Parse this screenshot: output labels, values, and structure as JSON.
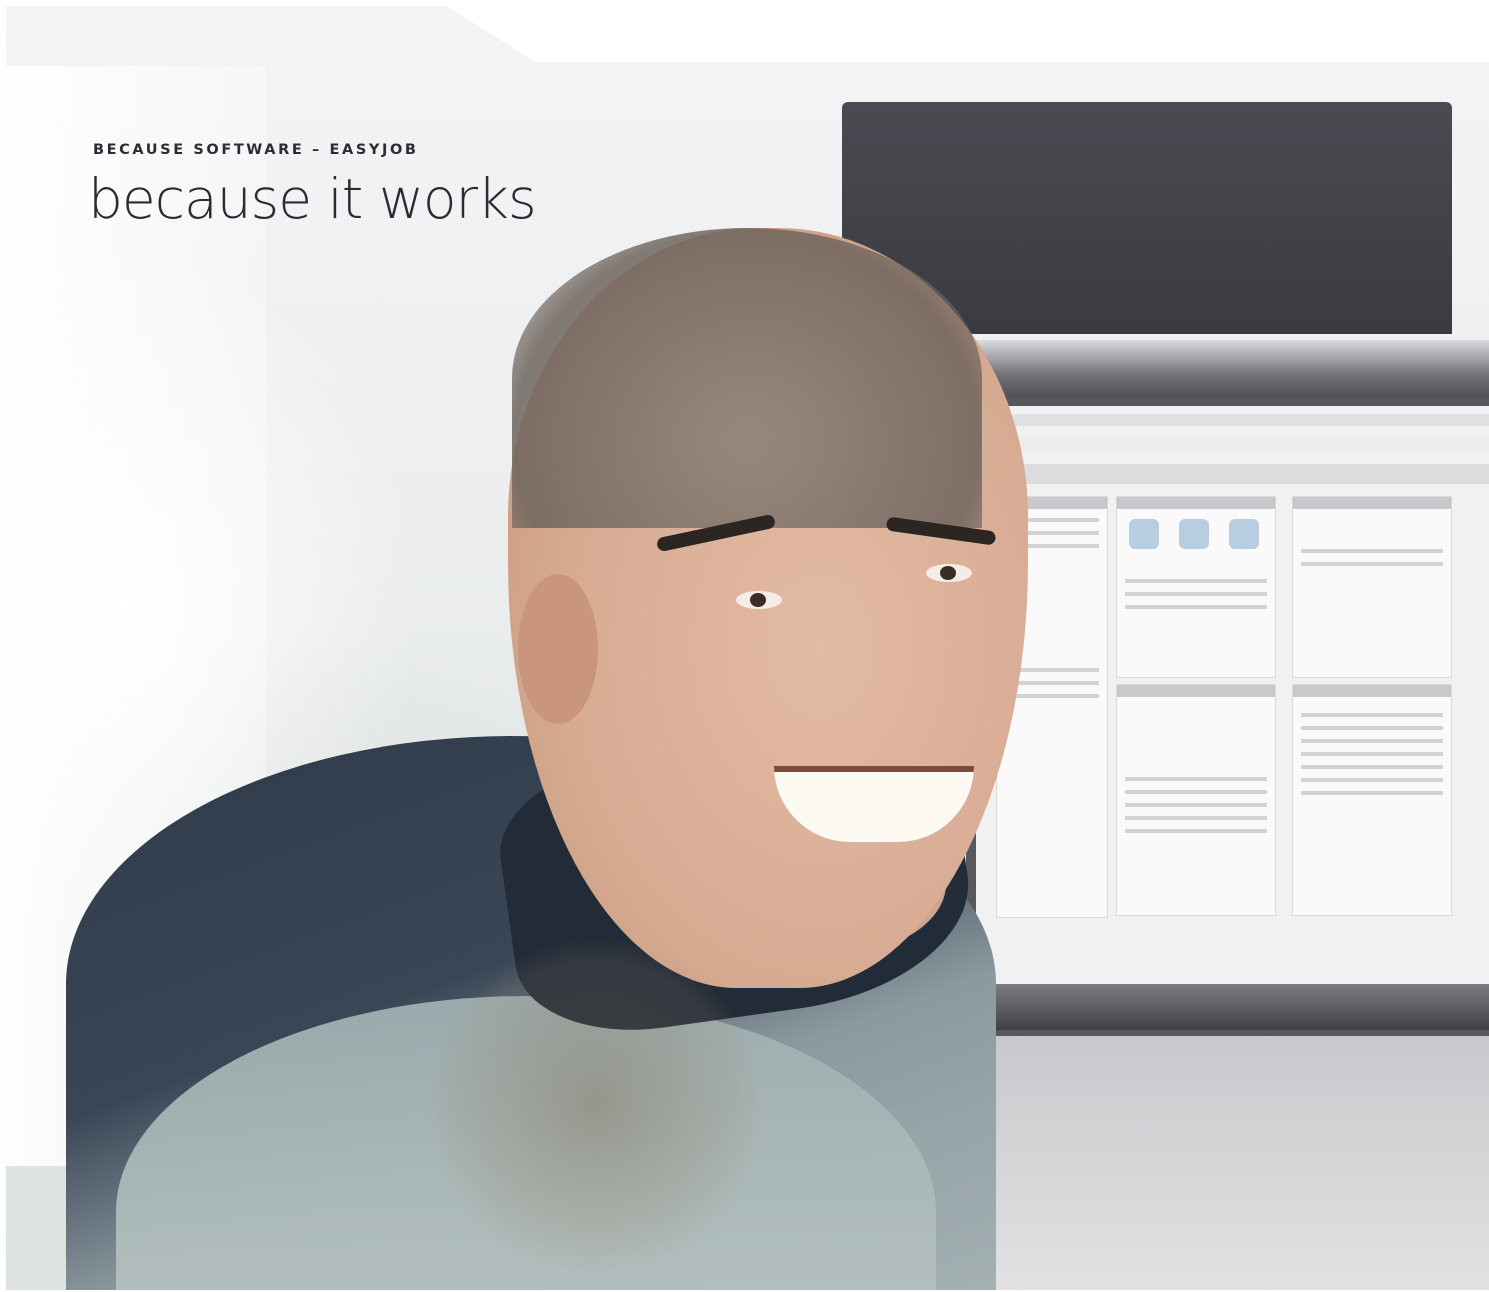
{
  "hero": {
    "eyebrow": "BECAUSE SOFTWARE – EASYJOB",
    "headline": "because it works"
  },
  "photo": {
    "subject": "smiling man at a computer",
    "icon": "photo-icon"
  },
  "colors": {
    "text": "#2a2c32",
    "background": "#ffffff"
  }
}
